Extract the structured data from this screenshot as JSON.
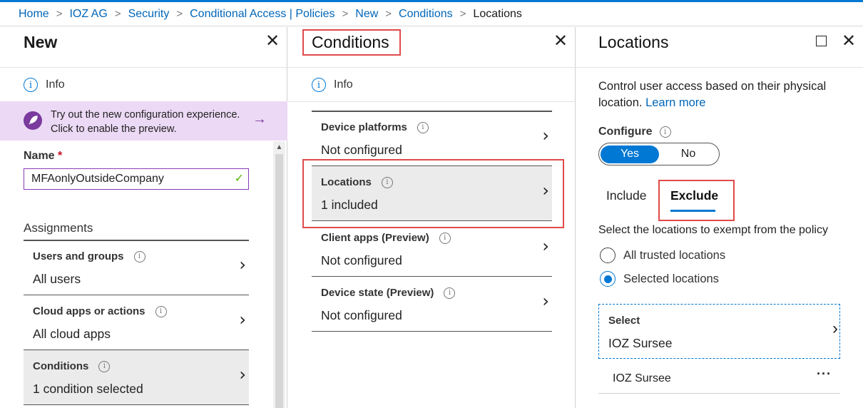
{
  "breadcrumb": {
    "items": [
      "Home",
      "IOZ AG",
      "Security",
      "Conditional Access | Policies",
      "New",
      "Conditions"
    ],
    "current": "Locations",
    "separator": ">"
  },
  "blade_new": {
    "title": "New",
    "info": "Info",
    "preview_banner": "Try out the new configuration experience. Click to enable the preview.",
    "name_label": "Name",
    "name_required": "*",
    "name_value": "MFAonlyOutsideCompany",
    "assignments_label": "Assignments",
    "items": [
      {
        "title": "Users and groups",
        "value": "All users"
      },
      {
        "title": "Cloud apps or actions",
        "value": "All cloud apps"
      },
      {
        "title": "Conditions",
        "value": "1 condition selected"
      }
    ]
  },
  "blade_conditions": {
    "title": "Conditions",
    "info": "Info",
    "items": [
      {
        "title": "Device platforms",
        "value": "Not configured"
      },
      {
        "title": "Locations",
        "value": "1 included"
      },
      {
        "title": "Client apps (Preview)",
        "value": "Not configured"
      },
      {
        "title": "Device state (Preview)",
        "value": "Not configured"
      }
    ]
  },
  "blade_locations": {
    "title": "Locations",
    "description": "Control user access based on their physical location.",
    "learn_more": "Learn more",
    "configure_label": "Configure",
    "toggle_yes": "Yes",
    "toggle_no": "No",
    "tab_include": "Include",
    "tab_exclude": "Exclude",
    "exempt_text": "Select the locations to exempt from the policy",
    "radio_all": "All trusted locations",
    "radio_selected": "Selected locations",
    "select_label": "Select",
    "select_value": "IOZ Sursee",
    "location_item": "IOZ Sursee"
  },
  "colors": {
    "accent": "#0078d4",
    "highlight_box": "#e04a4a",
    "preview_banner": "#ecd9f5"
  }
}
